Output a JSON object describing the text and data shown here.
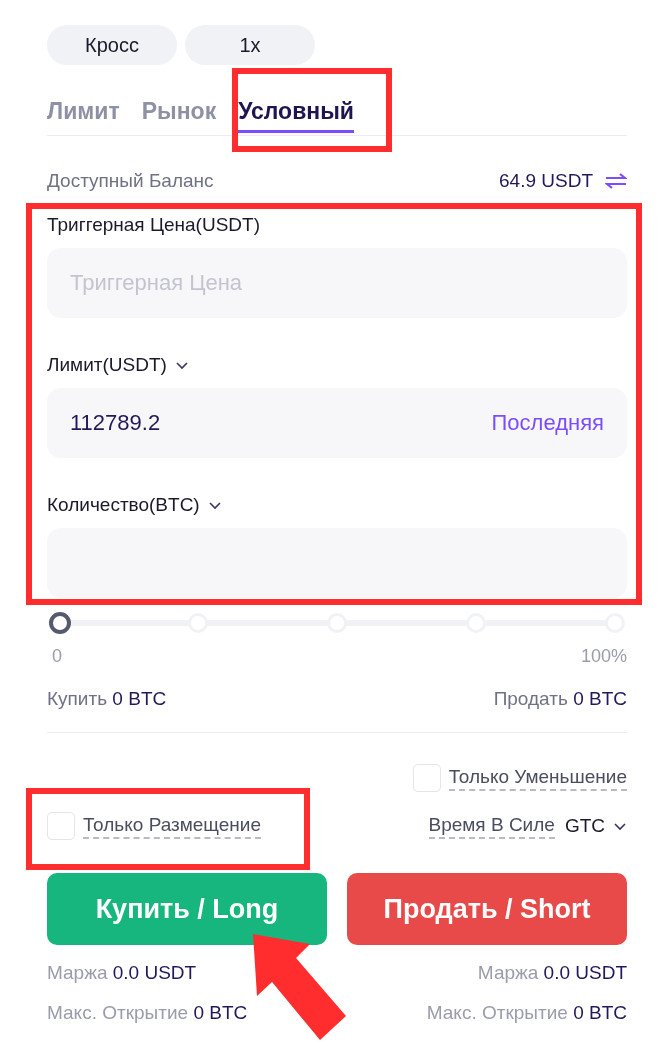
{
  "mode_pills": [
    {
      "label": "Кросс"
    },
    {
      "label": "1x"
    }
  ],
  "order_tabs": [
    {
      "label": "Лимит",
      "selected": false
    },
    {
      "label": "Рынок",
      "selected": false
    },
    {
      "label": "Условный",
      "selected": true
    }
  ],
  "balance": {
    "label": "Доступный Баланс",
    "value": "64.9 USDT"
  },
  "fields": [
    {
      "label": "Триггерная Цена(USDT)",
      "dropdown": false,
      "placeholder": "Триггерная Цена"
    },
    {
      "label": "Лимит(USDT)",
      "dropdown": true,
      "value": "112789.2",
      "action": "Последняя"
    },
    {
      "label": "Количество(BTC)",
      "dropdown": true
    }
  ],
  "slider": {
    "level": 0,
    "min_label": "0",
    "max_label": "100%"
  },
  "totals": [
    {
      "label": "Купить",
      "value": "0 BTC"
    },
    {
      "label": "Продать",
      "value": "0 BTC"
    }
  ],
  "reduce_only": {
    "label": "Только Уменьшение",
    "checked": false
  },
  "post_only": {
    "label": "Только Размещение",
    "checked": false
  },
  "time_in_force": {
    "label": "Время В Силе",
    "value": "GTC"
  },
  "buttons": [
    {
      "kind": "buy",
      "label": "Купить / Long"
    },
    {
      "kind": "sell",
      "label": "Продать / Short"
    }
  ],
  "buy_info": [
    {
      "label": "Маржа",
      "value": "0.0 USDT"
    },
    {
      "label": "Макс. Открытие",
      "value": "0 BTC"
    }
  ],
  "sell_info": [
    {
      "label": "Маржа",
      "value": "0.0 USDT"
    },
    {
      "label": "Макс. Открытие",
      "value": "0 BTC"
    }
  ]
}
